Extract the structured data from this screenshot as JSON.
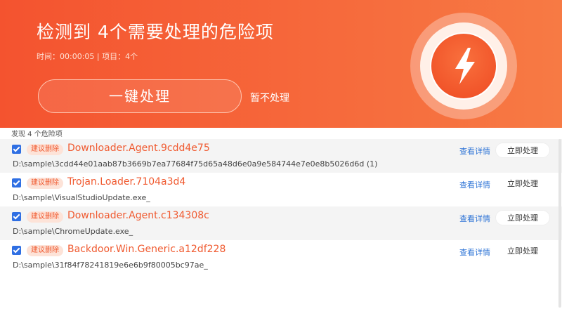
{
  "header": {
    "title": "检测到 4个需要处理的危险项",
    "meta": "时间：00:00:05 | 项目：4个",
    "primary_button": "一键处理",
    "skip_link": "暂不处理",
    "warning_icon": "lightning-bolt-icon"
  },
  "list": {
    "summary": "发现 4 个危险项",
    "items": [
      {
        "tag": "建议删除",
        "name": "Downloader.Agent.9cdd4e75",
        "path": "D:\\sample\\3cdd44e01aab87b3669b7ea77684f75d65a48d6e0a9e584744e7e0e8b5026d6d (1)",
        "view": "查看详情",
        "action": "立即处理",
        "checked": true
      },
      {
        "tag": "建议删除",
        "name": "Trojan.Loader.7104a3d4",
        "path": "D:\\sample\\VisualStudioUpdate.exe_",
        "view": "查看详情",
        "action": "立即处理",
        "checked": true
      },
      {
        "tag": "建议删除",
        "name": "Downloader.Agent.c134308c",
        "path": "D:\\sample\\ChromeUpdate.exe_",
        "view": "查看详情",
        "action": "立即处理",
        "checked": true
      },
      {
        "tag": "建议删除",
        "name": "Backdoor.Win.Generic.a12df228",
        "path": "D:\\sample\\31f84f78241819e6e6b9f80005bc97ae_",
        "view": "查看详情",
        "action": "立即处理",
        "checked": true
      }
    ]
  },
  "colors": {
    "header_start": "#f4532f",
    "header_end": "#f77a44",
    "threat_text": "#f05a30",
    "tag_bg": "#fde3d8",
    "link": "#2e74d6",
    "checkbox": "#2f6fe3"
  }
}
